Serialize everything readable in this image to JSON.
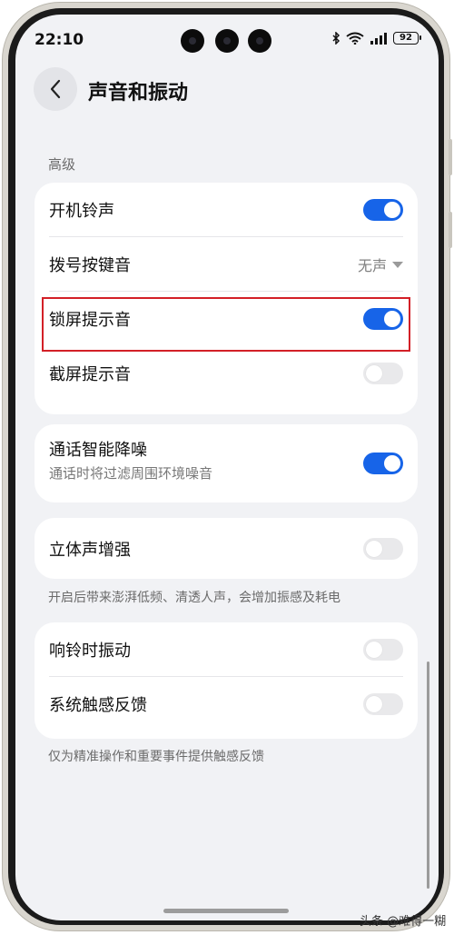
{
  "status_bar": {
    "time": "22:10",
    "battery": "92"
  },
  "header": {
    "title": "声音和振动"
  },
  "section": {
    "label": "高级"
  },
  "group1": [
    {
      "label": "开机铃声",
      "control": "toggle",
      "on": true
    },
    {
      "label": "拨号按键音",
      "control": "select",
      "value": "无声"
    },
    {
      "label": "锁屏提示音",
      "control": "toggle",
      "on": true
    },
    {
      "label": "截屏提示音",
      "control": "toggle",
      "on": false
    }
  ],
  "group2": {
    "label": "通话智能降噪",
    "subtitle": "通话时将过滤周围环境噪音",
    "on": true
  },
  "group3": {
    "label": "立体声增强",
    "on": false,
    "note": "开启后带来澎湃低频、清透人声，会增加振感及耗电"
  },
  "group4": [
    {
      "label": "响铃时振动",
      "on": false
    },
    {
      "label": "系统触感反馈",
      "on": false
    }
  ],
  "group4_note": "仅为精准操作和重要事件提供触感反馈",
  "watermark": "头条 @难得一糊",
  "colors": {
    "accent": "#1764e8",
    "highlight": "#d32027",
    "background": "#f1f2f5"
  }
}
